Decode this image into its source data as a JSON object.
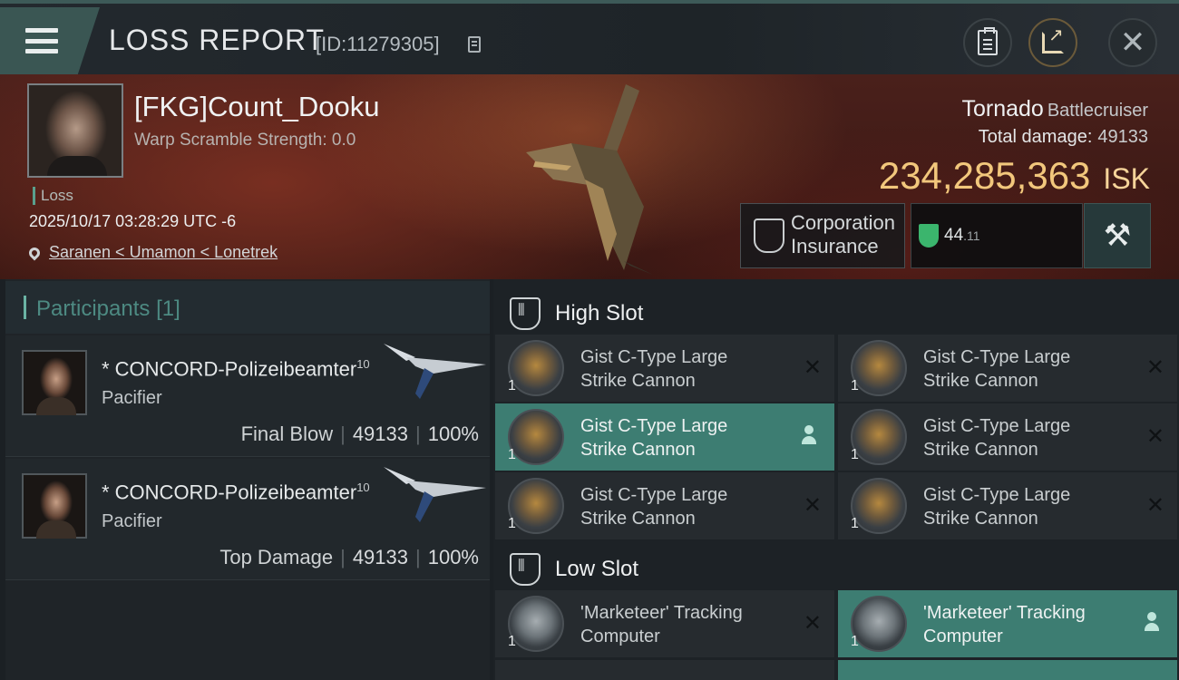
{
  "header": {
    "title": "LOSS REPORT",
    "report_id": "[ID:11279305]"
  },
  "victim": {
    "name": "[FKG]Count_Dooku",
    "scramble": "Warp Scramble Strength: 0.0",
    "tag": "Loss",
    "timestamp": "2025/10/17 03:28:29 UTC -6",
    "location": "Saranen < Umamon < Lonetrek",
    "ship_name": "Tornado",
    "ship_class": "Battlecruiser",
    "damage_label": "Total damage:",
    "damage_value": "49133",
    "isk_value": "234,285,363",
    "isk_unit": "ISK",
    "insurance_label_1": "Corporation",
    "insurance_label_2": "Insurance",
    "shield_value": "44",
    "shield_decimal": ".11"
  },
  "participants": {
    "heading": "Participants",
    "count": "[1]",
    "items": [
      {
        "name": "* CONCORD-Polizeibeamter",
        "level": "10",
        "ship": "Pacifier",
        "role": "Final Blow",
        "damage": "49133",
        "percent": "100%"
      },
      {
        "name": "* CONCORD-Polizeibeamter",
        "level": "10",
        "ship": "Pacifier",
        "role": "Top Damage",
        "damage": "49133",
        "percent": "100%"
      }
    ]
  },
  "fitting": {
    "high_slot_title": "High Slot",
    "low_slot_title": "Low Slot",
    "high_modules": [
      {
        "line1": "Gist C-Type Large",
        "line2": "Strike Cannon",
        "qty": "1"
      },
      {
        "line1": "Gist C-Type Large",
        "line2": "Strike Cannon",
        "qty": "1"
      },
      {
        "line1": "Gist C-Type Large",
        "line2": "Strike Cannon",
        "qty": "1"
      },
      {
        "line1": "Gist C-Type Large",
        "line2": "Strike Cannon",
        "qty": "1"
      },
      {
        "line1": "Gist C-Type Large",
        "line2": "Strike Cannon",
        "qty": "1"
      },
      {
        "line1": "Gist C-Type Large",
        "line2": "Strike Cannon",
        "qty": "1"
      }
    ],
    "low_modules": [
      {
        "line1": "'Marketeer' Tracking",
        "line2": "Computer",
        "qty": "1"
      },
      {
        "line1": "'Marketeer' Tracking",
        "line2": "Computer",
        "qty": "1"
      }
    ]
  },
  "icons": {
    "menu": "hamburger-menu-icon",
    "copy": "copy-icon",
    "clipboard": "clipboard-icon",
    "share": "share-icon",
    "close": "close-icon",
    "location": "map-pin-icon",
    "insurance": "insurance-icon",
    "shield": "shield-icon",
    "fitting": "wrench-icon",
    "dropped": "destroyed-x-icon",
    "dropped_loot": "pilot-icon"
  },
  "colors": {
    "accent": "#3d7d72",
    "isk": "#f2c77c",
    "banner": "#4a201b"
  }
}
